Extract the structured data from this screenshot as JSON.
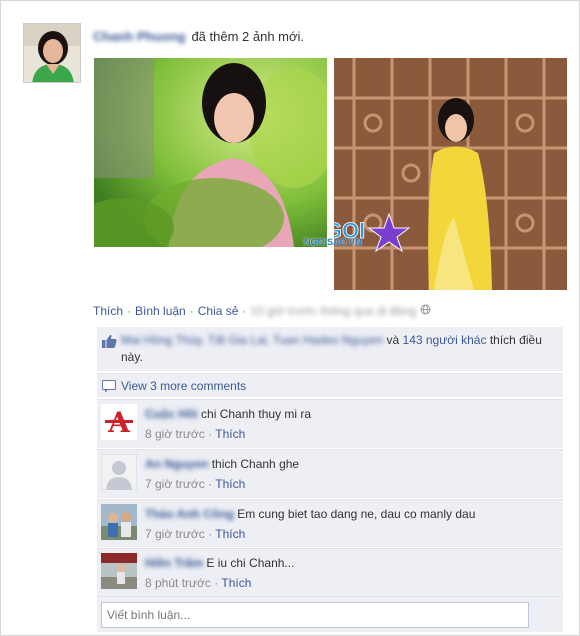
{
  "post": {
    "author": "Chanh Phuong",
    "action_text": "đã thêm 2 ảnh mới.",
    "watermark_brand": "NGOISAO",
    "watermark_url": "NGOISAO.VN"
  },
  "actions": {
    "like": "Thích",
    "comment": "Bình luận",
    "share": "Chia sẻ",
    "timestamp": "10 giờ trước thông qua di động"
  },
  "likes": {
    "names": "Mai Hồng Thúy, Tất Gia Lai, Tuan Hadeo Nguyen",
    "and": "và",
    "others": "143 người khác",
    "suffix": "thích điều này."
  },
  "more_comments": "View 3 more comments",
  "comments": [
    {
      "author": "Cuộc Hồi",
      "text": "chi Chanh thuy mi ra",
      "time": "8 giờ trước",
      "like": "Thích"
    },
    {
      "author": "An Nguyen",
      "text": "thich Chanh ghe",
      "time": "7 giờ trước",
      "like": "Thích"
    },
    {
      "author": "Thảo Anh Công",
      "text": "Em cung biet tao dang ne, dau co manly dau",
      "time": "7 giờ trước",
      "like": "Thích"
    },
    {
      "author": "Hiền Trâm",
      "text": "E iu chi Chanh...",
      "time": "8 phút trước",
      "like": "Thích"
    }
  ],
  "input": {
    "placeholder": "Viết bình luận..."
  }
}
